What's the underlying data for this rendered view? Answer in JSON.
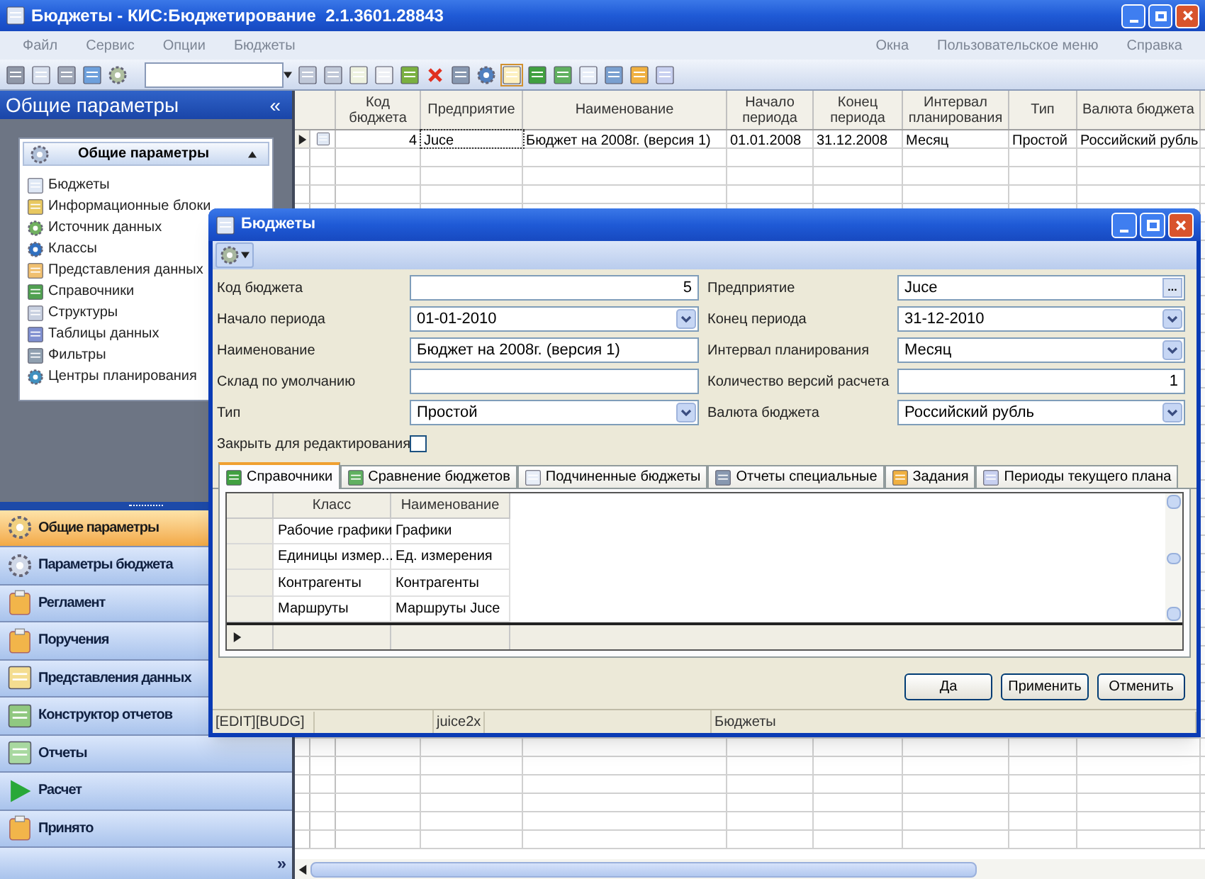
{
  "window": {
    "title": "Бюджеты - КИС:Бюджетирование  2.1.3601.28843"
  },
  "menu": {
    "left": [
      {
        "label": "Файл",
        "disabled": true
      },
      {
        "label": "Сервис",
        "disabled": true
      },
      {
        "label": "Опции",
        "disabled": true
      },
      {
        "label": "Бюджеты",
        "disabled": true
      }
    ],
    "right": [
      {
        "label": "Окна",
        "disabled": true
      },
      {
        "label": "Пользовательское меню",
        "disabled": true
      },
      {
        "label": "Справка",
        "disabled": true
      }
    ]
  },
  "sidebar": {
    "title": "Общие параметры",
    "collapse": "«",
    "card": {
      "title": "Общие параметры",
      "items": [
        "Бюджеты",
        "Информационные блоки",
        "Источник данных",
        "Классы",
        "Представления данных",
        "Справочники",
        "Структуры",
        "Таблицы данных",
        "Фильтры",
        "Центры планирования"
      ]
    },
    "nav": [
      {
        "label": "Общие параметры",
        "selected": true
      },
      {
        "label": "Параметры бюджета",
        "selected": false
      },
      {
        "label": "Регламент",
        "selected": false
      },
      {
        "label": "Поручения",
        "selected": false
      },
      {
        "label": "Представления данных",
        "selected": false
      },
      {
        "label": "Конструктор отчетов",
        "selected": false
      },
      {
        "label": "Отчеты",
        "selected": false
      },
      {
        "label": "Расчет",
        "selected": false
      },
      {
        "label": "Принято",
        "selected": false
      }
    ],
    "more": "»"
  },
  "grid": {
    "columns": [
      "Код бюджета",
      "Предприятие",
      "Наименование",
      "Начало периода",
      "Конец периода",
      "Интервал планирования",
      "Тип",
      "Валюта бюджета"
    ],
    "rows": [
      {
        "current": true,
        "cells": [
          "4",
          "Juce",
          "Бюджет на 2008г. (версия 1)",
          "01.01.2008",
          "31.12.2008",
          "Месяц",
          "Простой",
          "Российский рубль"
        ]
      }
    ]
  },
  "dialog": {
    "title": "Бюджеты",
    "fields": [
      {
        "label": "Код бюджета",
        "value": "5",
        "kind": "number"
      },
      {
        "label": "Предприятие",
        "value": "Juce",
        "kind": "lookup",
        "button": "..."
      },
      {
        "label": "Начало периода",
        "value": "01-01-2010",
        "kind": "combo"
      },
      {
        "label": "Конец периода",
        "value": "31-12-2010",
        "kind": "combo"
      },
      {
        "label": "Наименование",
        "value": "Бюджет на 2008г. (версия 1)",
        "kind": "text"
      },
      {
        "label": "Интервал планирования",
        "value": "Месяц",
        "kind": "combo"
      },
      {
        "label": "Склад по умолчанию",
        "kind": "text"
      },
      {
        "label": "Количество версий расчета",
        "value": "1",
        "kind": "number"
      },
      {
        "label": "Тип",
        "value": "Простой",
        "kind": "combo"
      },
      {
        "label": "Валюта бюджета",
        "value": "Российский рубль",
        "kind": "combo"
      }
    ],
    "lock": {
      "label": "Закрыть для редактирования",
      "checked": false
    },
    "tabs": [
      {
        "label": "Справочники",
        "selected": true
      },
      {
        "label": "Сравнение бюджетов",
        "selected": false
      },
      {
        "label": "Подчиненные бюджеты",
        "selected": false
      },
      {
        "label": "Отчеты специальные",
        "selected": false
      },
      {
        "label": "Задания",
        "selected": false
      },
      {
        "label": "Периоды текущего плана",
        "selected": false
      }
    ],
    "table": {
      "columns": [
        "Класс",
        "Наименование"
      ],
      "rows": [
        [
          "Рабочие графики",
          "Графики"
        ],
        [
          "Единицы измер...",
          "Ед. измерения"
        ],
        [
          "Контрагенты",
          "Контрагенты"
        ],
        [
          "Маршруты",
          "Маршруты Juce"
        ]
      ]
    },
    "buttons": [
      "Да",
      "Применить",
      "Отменить"
    ],
    "status": [
      "[EDIT][BUDG]",
      "juice2x",
      "Бюджеты"
    ]
  }
}
